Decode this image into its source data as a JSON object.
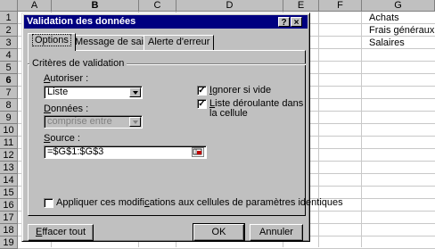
{
  "sheet": {
    "columns": [
      "A",
      "B",
      "C",
      "D",
      "E",
      "F",
      "G"
    ],
    "active_column": "B",
    "rows": [
      "1",
      "2",
      "3",
      "4",
      "5",
      "6",
      "7",
      "8",
      "9",
      "10",
      "11",
      "12",
      "13",
      "14",
      "15",
      "16",
      "17",
      "18",
      "19"
    ],
    "active_row": "6",
    "g_values": [
      "Achats",
      "Frais généraux",
      "Salaires"
    ]
  },
  "dialog": {
    "title": "Validation des données",
    "help_btn": "?",
    "close_btn": "×",
    "tabs": [
      "Options",
      "Message de saisie",
      "Alerte d'erreur"
    ],
    "group_label": "Critères de validation",
    "allow": {
      "label_u": "A",
      "label_rest": "utoriser :",
      "value": "Liste"
    },
    "data": {
      "label_u": "D",
      "label_rest": "onnées :",
      "value": "comprise entre"
    },
    "source": {
      "label_u": "S",
      "label_rest": "ource :",
      "value": "=$G$1:$G$3"
    },
    "ignore_blank": {
      "checked": true,
      "label_u": "I",
      "label_rest": "gnorer si vide"
    },
    "dropdown": {
      "checked": true,
      "label_u": "L",
      "label_rest": "iste déroulante dans",
      "label_line2": "la cellule"
    },
    "apply_all": {
      "checked": false,
      "label_pre": "Appliquer ces modifi",
      "label_u": "c",
      "label_rest": "ations aux cellules de paramètres identiques"
    },
    "buttons": {
      "clear_u": "E",
      "clear_rest": "ffacer tout",
      "ok": "OK",
      "cancel": "Annuler"
    },
    "check_mark": "✓"
  }
}
